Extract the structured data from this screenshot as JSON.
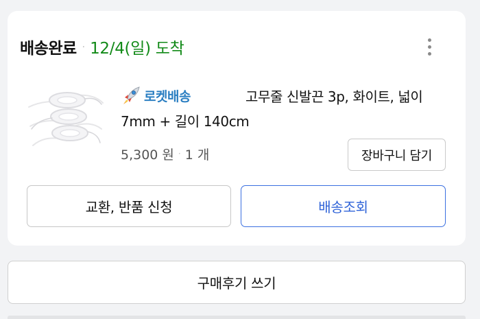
{
  "order": {
    "status": "배송완료",
    "separator": "·",
    "arrival": "12/4(일) 도착",
    "more_icon": "more-vertical-icon",
    "accent_color": "#128a18"
  },
  "product": {
    "rocket_label": "로켓배송",
    "rocket_icon": "rocket-icon",
    "title_line1": "고무줄 신발끈 3p, 화이트, 넓이",
    "title_line2": "7mm + 길이 140cm",
    "price": "5,300 원",
    "qty_separator": "·",
    "quantity": "1 개",
    "add_to_cart_label": "장바구니 담기"
  },
  "actions": {
    "exchange_return_label": "교환, 반품 신청",
    "track_shipping_label": "배송조회",
    "track_color": "#2f63d8"
  },
  "review": {
    "write_review_label": "구매후기 쓰기"
  }
}
